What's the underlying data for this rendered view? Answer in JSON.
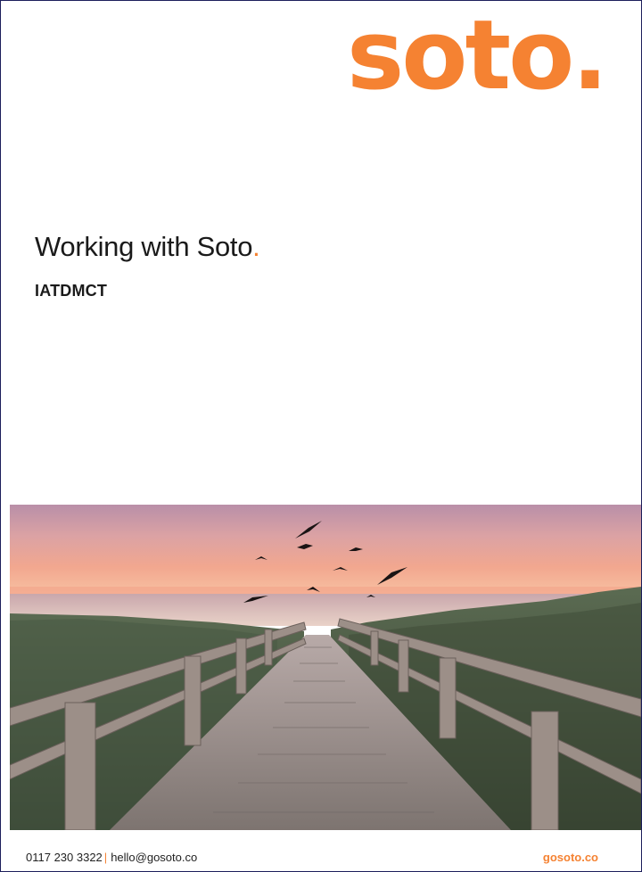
{
  "brand": {
    "logo_text": "soto.",
    "accent_color": "#f58232"
  },
  "cover": {
    "title": "Working with Soto",
    "title_dot": ".",
    "subtitle": "IATDMCT"
  },
  "footer": {
    "phone": "0117 230 3322",
    "separator": "|",
    "email": "hello@gosoto.co",
    "website": "gosoto.co"
  }
}
